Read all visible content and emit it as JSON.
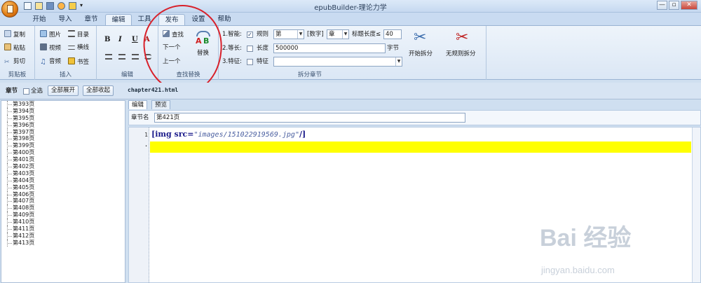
{
  "window": {
    "title": "epubBuilder-理论力学",
    "minimize": "—",
    "restore": "▫",
    "close": "✕"
  },
  "tabs": [
    "开始",
    "导入",
    "章节",
    "编辑",
    "工具",
    "发布",
    "设置",
    "帮助"
  ],
  "active_tab": "编辑",
  "ribbon": {
    "clipboard": {
      "label": "剪贴板",
      "copy": "复制",
      "paste": "粘贴",
      "cut": "剪切"
    },
    "insert": {
      "label": "插入",
      "image": "图片",
      "toc": "目录",
      "video": "视频",
      "hline": "横线",
      "audio": "音频",
      "bookmark": "书签"
    },
    "edit": {
      "label": "编辑",
      "bold": "B",
      "italic": "I",
      "underline": "U",
      "color": "A"
    },
    "find_replace": {
      "label": "查找替换",
      "find": "查找",
      "next": "下一个",
      "prev": "上一个",
      "replace": "替换"
    },
    "split": {
      "label": "拆分章节",
      "smart": "1.智能:",
      "rule": "规则",
      "rule_value": "第",
      "bracket_num": "[数字]",
      "chapter_value": "章",
      "title_len": "标题长度≤",
      "title_len_value": "40",
      "equal_len": "2.等长:",
      "length": "长度",
      "length_value": "500000",
      "unit": "字节",
      "feature": "3.特征:",
      "feature_label": "特征",
      "feature_value": "",
      "start_split": "开始拆分",
      "no_rule_split": "无规则拆分"
    }
  },
  "left_pane": {
    "title": "章节",
    "select_all": "全选",
    "expand_all": "全部展开",
    "collapse_all": "全部收起",
    "items": [
      "第393页",
      "第394页",
      "第395页",
      "第396页",
      "第397页",
      "第398页",
      "第399页",
      "第400页",
      "第401页",
      "第402页",
      "第403页",
      "第404页",
      "第405页",
      "第406页",
      "第407页",
      "第408页",
      "第409页",
      "第410页",
      "第411页",
      "第412页",
      "第413页"
    ]
  },
  "editor": {
    "file_name": "chapter421.html",
    "tabs": [
      "编辑",
      "预览"
    ],
    "chapter_label": "章节名",
    "chapter_name": "第421页",
    "line1_num": "1",
    "line2_num": "·",
    "line1_code_open": "[img src=",
    "line1_code_value": "\"images/151022919569.jpg\"",
    "line1_code_close": "/]"
  },
  "watermark": {
    "text": "Bai 经验",
    "url": "jingyan.baidu.com"
  },
  "colors": {
    "highlight": "#ffff00",
    "annotation": "#d8202a",
    "ribbon": "#dbe7f5"
  }
}
